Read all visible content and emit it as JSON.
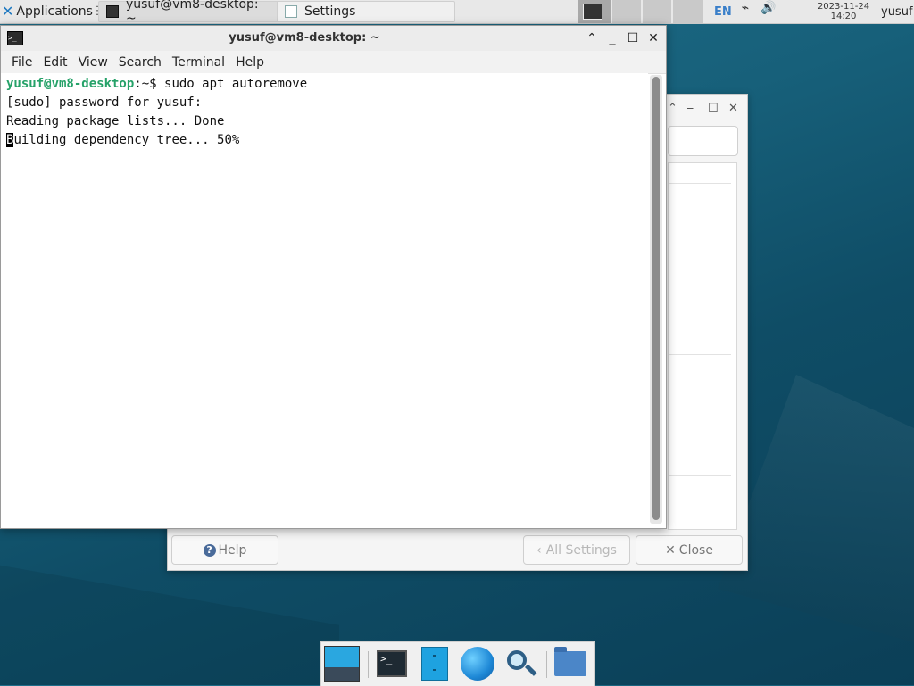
{
  "top_panel": {
    "applications_label": "Applications",
    "tasks": [
      {
        "title": "yusuf@vm8-desktop: ~",
        "icon": "terminal-icon"
      },
      {
        "title": "Settings",
        "icon": "settings-icon"
      }
    ],
    "keyboard_layout": "EN",
    "clock_date": "2023-11-24",
    "clock_time": "14:20",
    "user": "yusuf"
  },
  "terminal": {
    "title": "yusuf@vm8-desktop: ~",
    "menu": [
      "File",
      "Edit",
      "View",
      "Search",
      "Terminal",
      "Help"
    ],
    "lines": {
      "prompt_user": "yusuf@vm8-desktop",
      "prompt_rest": ":~$ sudo apt autoremove",
      "line2": "[sudo] password for yusuf:",
      "line3": "Reading package lists... Done",
      "line4_cursor": "B",
      "line4_rest": "uilding dependency tree... 50%"
    }
  },
  "settings_window": {
    "help_label": "Help",
    "all_settings_label": "All Settings",
    "close_label": "Close"
  },
  "dock": {
    "items": [
      "show-desktop-icon",
      "terminal-icon",
      "file-manager-icon",
      "web-browser-icon",
      "app-finder-icon",
      "home-folder-icon"
    ]
  },
  "colors": {
    "prompt_green": "#26a269",
    "desktop_bg": "#17607a",
    "accent_blue": "#1ea2e0"
  }
}
